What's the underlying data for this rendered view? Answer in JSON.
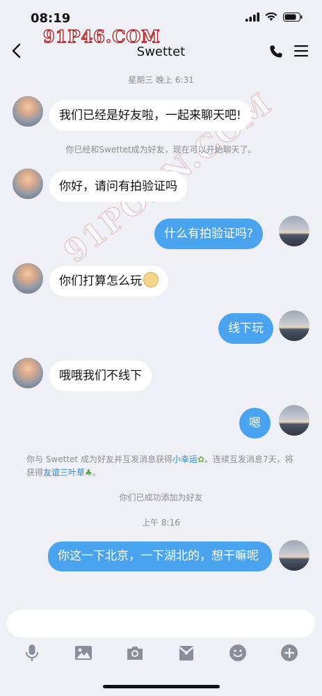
{
  "status_bar": {
    "time": "08:19"
  },
  "watermarks": {
    "top": "91P46.COM",
    "diagonal": "91PORN.COM"
  },
  "header": {
    "title": "Swettet",
    "icons": [
      "back-icon",
      "phone-icon",
      "menu-icon"
    ]
  },
  "messages": {
    "ts1": "星期三 晚上 6:31",
    "m1": "我们已经是好友啦，一起来聊天吧!",
    "sys1": "你已经和Swettet成为好友，现在可以开始聊天了。",
    "m2": "你好，请问有拍验证吗",
    "m3": "什么有拍验证吗?",
    "m4": "你们打算怎么玩",
    "m5": "线下玩",
    "m6": "哦哦我们不线下",
    "m7": "嗯",
    "sys2_a": "你与 Swettet 成为好友并互发消息获得",
    "sys2_link1": "小幸运",
    "sys2_b": "。连续互发消息7天，将获得",
    "sys2_link2": "友谊三叶草",
    "sys2_c": "。",
    "sys3": "你们已成功添加为好友",
    "ts2": "上午 8:16",
    "m8": "你这一下北京，一下湖北的，想干嘛呢"
  },
  "toolbar": {
    "icons": [
      "microphone-icon",
      "image-icon",
      "camera-icon",
      "red-packet-icon",
      "emoji-icon",
      "plus-icon"
    ]
  },
  "colors": {
    "outgoing_bubble": "#4aa3ee",
    "incoming_bubble": "#ffffff",
    "background": "#eef0f6",
    "link": "#2f86d6"
  }
}
